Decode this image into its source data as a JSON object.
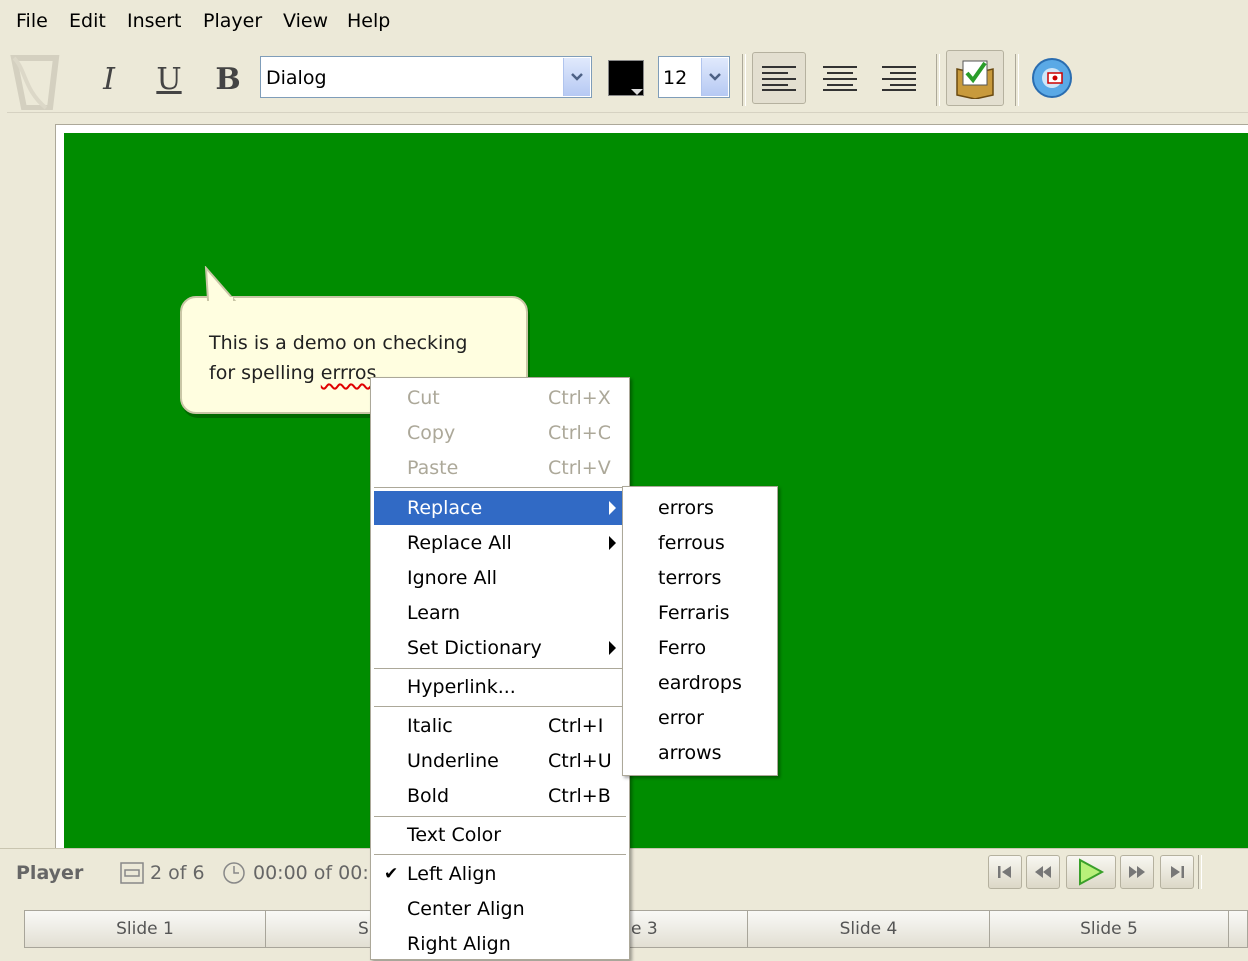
{
  "menubar": {
    "items": [
      "File",
      "Edit",
      "Insert",
      "Player",
      "View",
      "Help"
    ]
  },
  "toolbar": {
    "italic_label": "I",
    "underline_label": "U",
    "bold_label": "B",
    "font_value": "Dialog",
    "color_value": "#000000",
    "size_value": "12"
  },
  "callout": {
    "text_line1": "This is a demo on checking",
    "text_line2_prefix": "for spelling ",
    "text_line2_word": "errros"
  },
  "context_menu": {
    "cut": "Cut",
    "cut_sc": "Ctrl+X",
    "copy": "Copy",
    "copy_sc": "Ctrl+C",
    "paste": "Paste",
    "paste_sc": "Ctrl+V",
    "replace": "Replace",
    "replace_all": "Replace All",
    "ignore_all": "Ignore All",
    "learn": "Learn",
    "set_dictionary": "Set Dictionary",
    "hyperlink": "Hyperlink...",
    "italic": "Italic",
    "italic_sc": "Ctrl+I",
    "underline": "Underline",
    "underline_sc": "Ctrl+U",
    "bold": "Bold",
    "bold_sc": "Ctrl+B",
    "text_color": "Text Color",
    "left_align": "Left Align",
    "center_align": "Center Align",
    "right_align": "Right Align",
    "checked_mark": "✔"
  },
  "replace_submenu": {
    "items": [
      "errors",
      "ferrous",
      "terrors",
      "Ferraris",
      "Ferro",
      "eardrops",
      "error",
      "arrows"
    ]
  },
  "player": {
    "label": "Player",
    "slide_counter": "2 of 6",
    "time": "00:00 of 00:0"
  },
  "slides": {
    "tabs": [
      "Slide 1",
      "S",
      "e 3",
      "Slide 4",
      "Slide 5"
    ]
  },
  "colors": {
    "canvas": "#008c00",
    "menu_highlight": "#316ac5",
    "callout_fill": "#fffee0"
  }
}
